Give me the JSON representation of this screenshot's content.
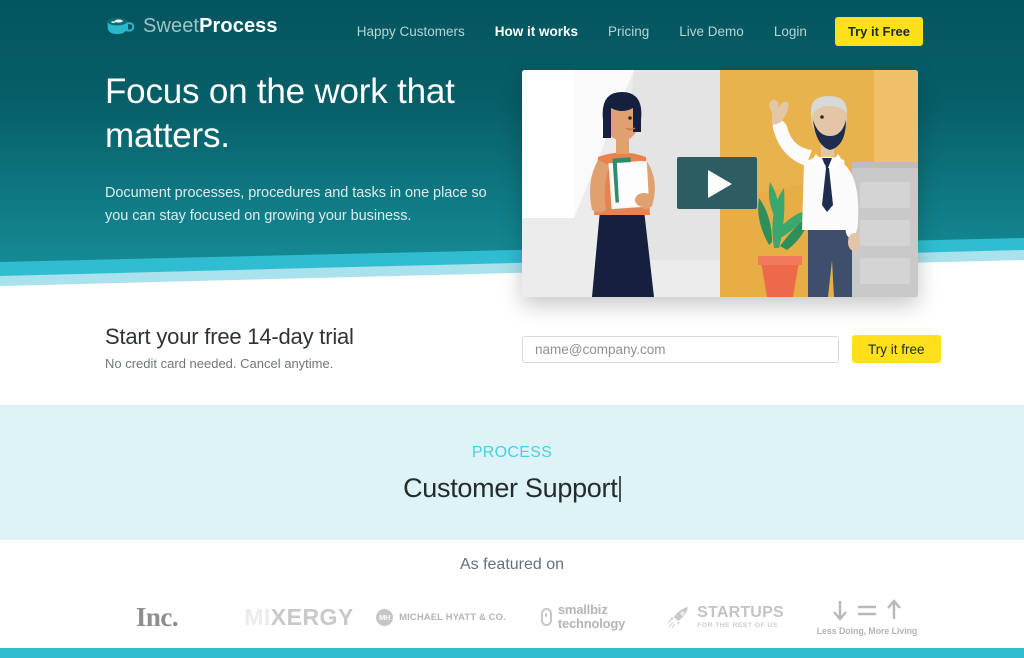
{
  "brand": {
    "name_light": "Sweet",
    "name_bold": "Process",
    "icon": "coffee-cup-icon"
  },
  "nav": {
    "links": [
      {
        "label": "Happy Customers",
        "active": false
      },
      {
        "label": "How it works",
        "active": true
      },
      {
        "label": "Pricing",
        "active": false
      },
      {
        "label": "Live Demo",
        "active": false
      },
      {
        "label": "Login",
        "active": false
      }
    ],
    "cta_label": "Try it Free"
  },
  "hero": {
    "title_line1": "Focus on the work that",
    "title_line2": "matters.",
    "subtitle_line1": "Document processes, procedures and tasks in one place so",
    "subtitle_line2": "you can stay focused on growing your business.",
    "video": {
      "play_icon": "play-button-icon",
      "alt": "Two illustrated coworkers in an office"
    }
  },
  "trial": {
    "title": "Start your free 14-day trial",
    "note": "No credit card needed. Cancel anytime.",
    "email_placeholder": "name@company.com",
    "email_value": "",
    "button_label": "Try it free"
  },
  "process_band": {
    "eyebrow": "PROCESS",
    "name": "Customer Support"
  },
  "featured": {
    "title": "As featured on",
    "logos": [
      {
        "id": "inc",
        "text": "Inc."
      },
      {
        "id": "mixergy",
        "dim": "MI",
        "lit": "XERGY"
      },
      {
        "id": "michael-hyatt",
        "badge": "MH",
        "text": "MICHAEL HYATT & CO."
      },
      {
        "id": "smallbiz",
        "line1": "smallbiz",
        "line2": "technology"
      },
      {
        "id": "startups",
        "main": "STARTUPS",
        "sub": "FOR THE REST OF US"
      },
      {
        "id": "less-doing",
        "text": "Less Doing, More Living"
      }
    ]
  },
  "colors": {
    "hero_top": "#03555f",
    "hero_bottom": "#1a939d",
    "wave_mid": "#30bdd2",
    "wave_light": "#a9e2ec",
    "accent_yellow": "#ffe01b",
    "process_band_bg": "#ddf3f6",
    "process_eyebrow": "#46d0e8",
    "bottom_bar": "#30bdd2"
  }
}
